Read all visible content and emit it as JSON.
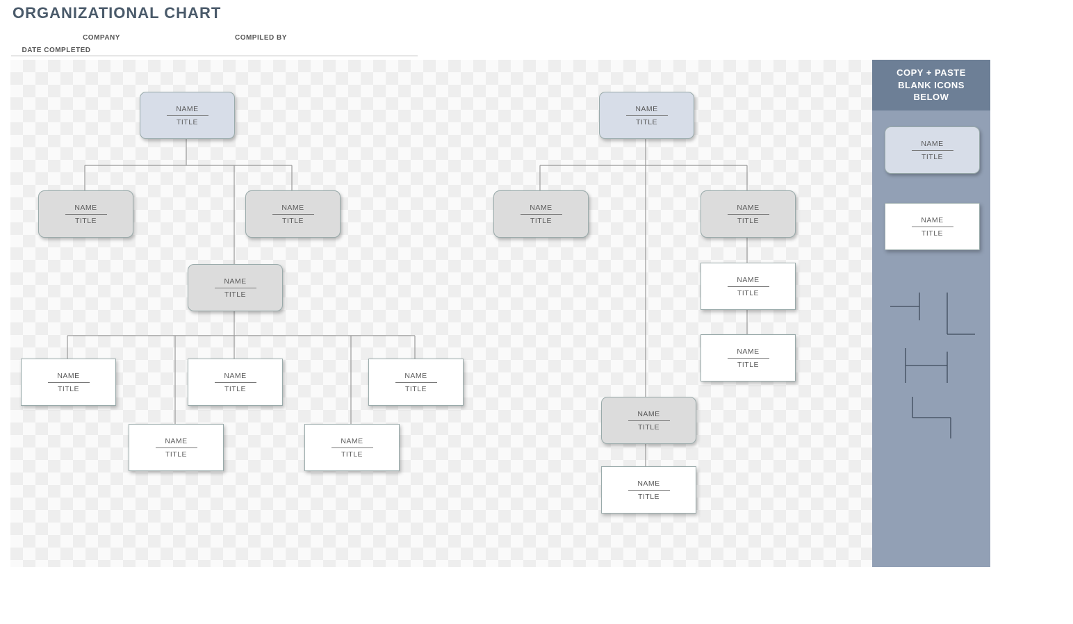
{
  "header": {
    "title": "ORGANIZATIONAL CHART",
    "meta": {
      "company": "COMPANY",
      "compiled_by": "COMPILED BY",
      "date_completed": "DATE COMPLETED"
    }
  },
  "sidebar": {
    "heading_l1": "COPY + PASTE",
    "heading_l2": "BLANK ICONS",
    "heading_l3": "BELOW",
    "template_blue": {
      "name": "NAME",
      "title": "TITLE"
    },
    "template_white": {
      "name": "NAME",
      "title": "TITLE"
    }
  },
  "nodes": {
    "a_root": {
      "name": "NAME",
      "title": "TITLE"
    },
    "a_l2a": {
      "name": "NAME",
      "title": "TITLE"
    },
    "a_l2b": {
      "name": "NAME",
      "title": "TITLE"
    },
    "a_l3": {
      "name": "NAME",
      "title": "TITLE"
    },
    "a_l4a": {
      "name": "NAME",
      "title": "TITLE"
    },
    "a_l4b": {
      "name": "NAME",
      "title": "TITLE"
    },
    "a_l4c": {
      "name": "NAME",
      "title": "TITLE"
    },
    "a_l4d": {
      "name": "NAME",
      "title": "TITLE"
    },
    "a_l4e": {
      "name": "NAME",
      "title": "TITLE"
    },
    "b_root": {
      "name": "NAME",
      "title": "TITLE"
    },
    "b_l2a": {
      "name": "NAME",
      "title": "TITLE"
    },
    "b_l2b": {
      "name": "NAME",
      "title": "TITLE"
    },
    "b_l3": {
      "name": "NAME",
      "title": "TITLE"
    },
    "b_l4": {
      "name": "NAME",
      "title": "TITLE"
    },
    "b_c1": {
      "name": "NAME",
      "title": "TITLE"
    },
    "b_c2": {
      "name": "NAME",
      "title": "TITLE"
    }
  }
}
